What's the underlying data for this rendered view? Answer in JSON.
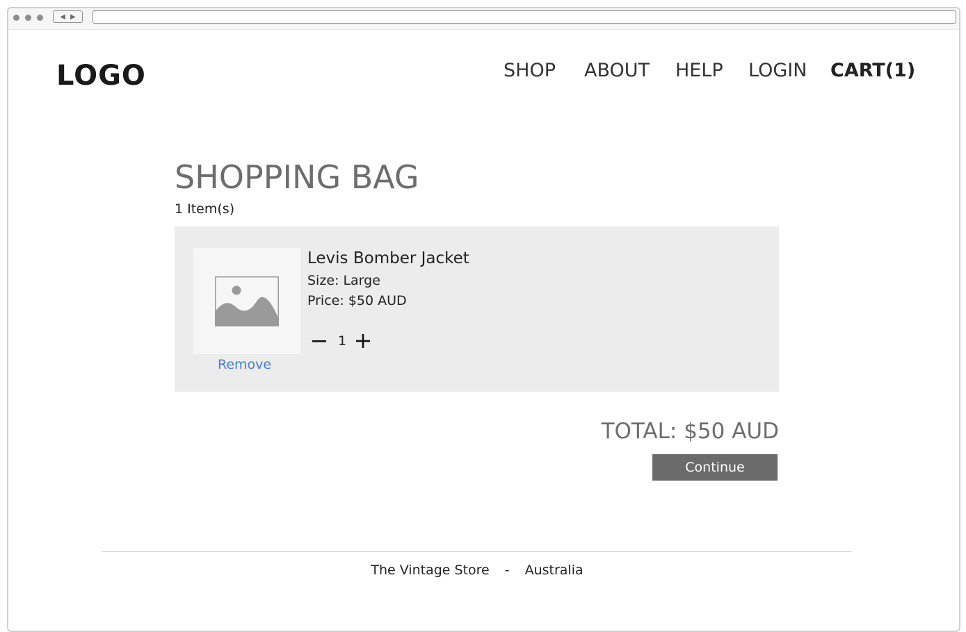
{
  "browser": {
    "nav_icon": "back-forward-arrows"
  },
  "header": {
    "logo": "LOGO",
    "nav": [
      "SHOP",
      "ABOUT",
      "HELP",
      "LOGIN"
    ],
    "cart": "CART(1)"
  },
  "main": {
    "title": "SHOPPING BAG",
    "item_count": "1 Item(s)",
    "items": [
      {
        "name": "Levis Bomber Jacket",
        "size": "Size: Large",
        "price": "Price: $50 AUD",
        "quantity": "1",
        "remove_label": "Remove",
        "image_icon": "image-placeholder-icon"
      }
    ],
    "total": "TOTAL: $50 AUD",
    "continue_label": "Continue"
  },
  "footer": {
    "store": "The Vintage Store",
    "separator": "-",
    "country": "Australia"
  },
  "colors": {
    "panel_bg": "#ececec",
    "link": "#4a7fd0",
    "button_bg": "#6b6b6b",
    "title_gray": "#6d6d6d"
  }
}
